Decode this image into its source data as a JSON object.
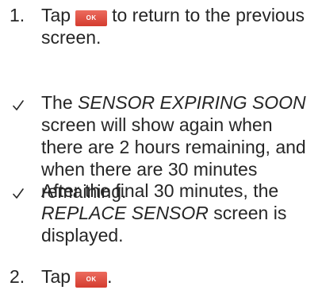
{
  "steps": [
    {
      "number": "1.",
      "text_before": "Tap",
      "button": "OK",
      "text_after": "to return to the previous screen."
    },
    {
      "number": "2.",
      "text_before": "Tap",
      "button": "OK",
      "text_after": "."
    }
  ],
  "notes": [
    {
      "marker_icon": "checkmark-icon",
      "before": "The ",
      "emphasis": "SENSOR EXPIRING SOON",
      "after": " screen will show again when there are 2 hours remaining, and when there are 30 minutes remaining."
    },
    {
      "marker_icon": "checkmark-icon",
      "before": "After the final 30 minutes, the ",
      "emphasis": "REPLACE SENSOR",
      "after": " screen is displayed."
    }
  ],
  "colors": {
    "text": "#262626",
    "ok_button_top": "#ec6b5e",
    "ok_button_bottom": "#d43c2f"
  }
}
